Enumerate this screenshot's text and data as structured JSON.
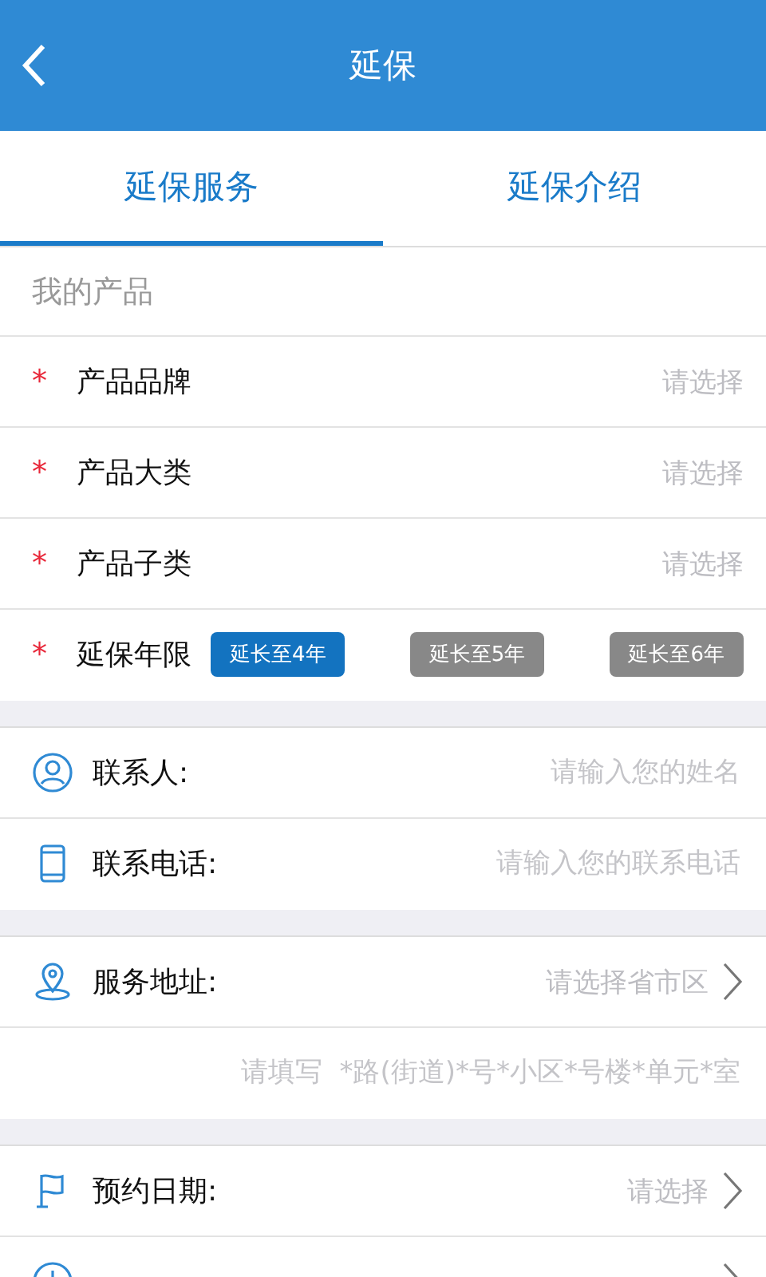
{
  "header": {
    "title": "延保"
  },
  "tabs": [
    {
      "label": "延保服务",
      "selected": true
    },
    {
      "label": "延保介绍",
      "selected": false
    }
  ],
  "sections": [
    {
      "title": "我的产品",
      "rows": [
        {
          "kind": "select",
          "mark": "*",
          "label": "产品品牌",
          "hint": "请选择"
        },
        {
          "kind": "select",
          "mark": "*",
          "label": "产品大类",
          "hint": "请选择"
        },
        {
          "kind": "select",
          "mark": "*",
          "label": "产品子类",
          "hint": "请选择"
        },
        {
          "kind": "years",
          "mark": "*",
          "label": "延保年限",
          "options": [
            {
              "label": "延长至4年",
              "selected": true
            },
            {
              "label": "延长至5年",
              "selected": false
            },
            {
              "label": "延长至6年",
              "selected": false
            }
          ]
        }
      ]
    },
    {
      "rows": [
        {
          "kind": "name",
          "label": "联系人:",
          "placeholder": "请输入您的姓名"
        },
        {
          "kind": "phone",
          "label": "联系电话:",
          "placeholder": "请输入您的联系电话"
        }
      ]
    },
    {
      "rows": [
        {
          "kind": "address",
          "label": "服务地址:",
          "hint": "请选择省市区"
        },
        {
          "kind": "detail",
          "placeholder": "请填写  *路(街道)*号*小区*号楼*单元*室"
        }
      ]
    },
    {
      "rows": [
        {
          "kind": "date",
          "label": "预约日期:",
          "hint": "请选择"
        },
        {
          "kind": "time"
        }
      ]
    }
  ]
}
